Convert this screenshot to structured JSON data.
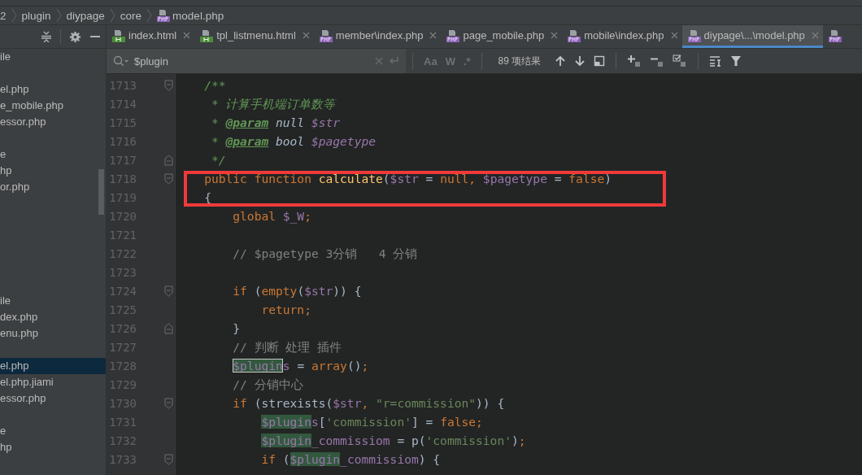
{
  "breadcrumb": [
    {
      "label": "2",
      "kind": "folder"
    },
    {
      "label": "plugin",
      "kind": "folder"
    },
    {
      "label": "diypage",
      "kind": "folder"
    },
    {
      "label": "core",
      "kind": "folder"
    },
    {
      "label": "model.php",
      "kind": "php"
    }
  ],
  "sidebar": {
    "items": [
      {
        "kind": "file",
        "label": "ile",
        "selected": false
      },
      {
        "kind": "hidden"
      },
      {
        "kind": "file",
        "label": "el.php",
        "selected": false
      },
      {
        "kind": "file",
        "label": "e_mobile.php",
        "selected": false
      },
      {
        "kind": "file",
        "label": "essor.php",
        "selected": false
      },
      {
        "kind": "hidden"
      },
      {
        "kind": "file",
        "label": "e",
        "selected": false
      },
      {
        "kind": "file",
        "label": "hp",
        "selected": false
      },
      {
        "kind": "file",
        "label": "or.php",
        "selected": false
      },
      {
        "kind": "hidden"
      },
      {
        "kind": "hidden"
      },
      {
        "kind": "hidden"
      },
      {
        "kind": "hidden"
      },
      {
        "kind": "hidden"
      },
      {
        "kind": "hidden"
      },
      {
        "kind": "file",
        "label": "ile",
        "selected": false
      },
      {
        "kind": "file",
        "label": "dex.php",
        "selected": false
      },
      {
        "kind": "file",
        "label": "enu.php",
        "selected": false
      },
      {
        "kind": "hidden"
      },
      {
        "kind": "file",
        "label": "el.php",
        "selected": true
      },
      {
        "kind": "file",
        "label": "el.php.jiami",
        "selected": false
      },
      {
        "kind": "file",
        "label": "essor.php",
        "selected": false
      },
      {
        "kind": "hidden"
      },
      {
        "kind": "file",
        "label": "e",
        "selected": false
      },
      {
        "kind": "file",
        "label": "hp",
        "selected": false
      }
    ]
  },
  "tabs": [
    {
      "label": "index.html",
      "kind": "html",
      "selected": false
    },
    {
      "label": "tpl_listmenu.html",
      "kind": "html",
      "selected": false
    },
    {
      "label": "member\\index.php",
      "kind": "php",
      "selected": false
    },
    {
      "label": "page_mobile.php",
      "kind": "php",
      "selected": false
    },
    {
      "label": "mobile\\index.php",
      "kind": "php",
      "selected": false
    },
    {
      "label": "diypage\\...\\model.php",
      "kind": "php",
      "selected": true
    },
    {
      "kind": "php",
      "selected": false
    }
  ],
  "search": {
    "value": "$plugin",
    "options": [
      "Aa",
      "W",
      ".*"
    ],
    "result_count": "89 项结果"
  },
  "code": [
    {
      "number": "1713",
      "fold_start": true,
      "fold_end": false,
      "boxed": false,
      "tokens": [
        {
          "text": "/**",
          "kind": "doc"
        }
      ]
    },
    {
      "number": "1714",
      "fold_start": false,
      "fold_end": false,
      "boxed": false,
      "tokens": [
        {
          "text": " * 计算手机端订单数等",
          "kind": "doc"
        }
      ]
    },
    {
      "number": "1715",
      "fold_start": false,
      "fold_end": false,
      "boxed": false,
      "tokens": [
        {
          "text": " * ",
          "kind": "doc"
        },
        {
          "text": "@param",
          "kind": "doctag"
        },
        {
          "text": " null ",
          "kind": "doctype"
        },
        {
          "text": "$str",
          "kind": "docvar"
        }
      ]
    },
    {
      "number": "1716",
      "fold_start": false,
      "fold_end": false,
      "boxed": false,
      "tokens": [
        {
          "text": " * ",
          "kind": "doc"
        },
        {
          "text": "@param",
          "kind": "doctag"
        },
        {
          "text": " bool ",
          "kind": "doctype"
        },
        {
          "text": "$pagetype",
          "kind": "docvar"
        }
      ]
    },
    {
      "number": "1717",
      "fold_start": false,
      "fold_end": true,
      "boxed": false,
      "tokens": [
        {
          "text": " */",
          "kind": "doc"
        }
      ]
    },
    {
      "number": "1718",
      "fold_start": true,
      "fold_end": false,
      "boxed": true,
      "tokens": [
        {
          "text": "public function",
          "kind": "keyword"
        },
        {
          "text": " calculate",
          "kind": "function"
        },
        {
          "text": "(",
          "kind": "plain"
        },
        {
          "text": "$str",
          "kind": "variable"
        },
        {
          "text": " = ",
          "kind": "plain"
        },
        {
          "text": "null,",
          "kind": "keyword"
        },
        {
          "text": " $pagetype",
          "kind": "variable"
        },
        {
          "text": " = ",
          "kind": "plain"
        },
        {
          "text": "false",
          "kind": "keyword"
        },
        {
          "text": ")",
          "kind": "plain"
        }
      ]
    },
    {
      "number": "1719",
      "fold_start": false,
      "fold_end": false,
      "boxed": true,
      "tokens": [
        {
          "text": "{",
          "kind": "plain"
        }
      ],
      "children": [
        {
          "number": "1720",
          "fold_start": false,
          "fold_end": false,
          "boxed": false,
          "tokens": [
            {
              "text": "global",
              "kind": "keyword"
            },
            {
              "text": " $_W",
              "kind": "variable"
            },
            {
              "text": ";",
              "kind": "keyword"
            }
          ]
        },
        {
          "number": "1721",
          "fold_start": false,
          "fold_end": false,
          "boxed": false
        },
        {
          "number": "1722",
          "fold_start": false,
          "fold_end": false,
          "boxed": false,
          "tokens": [
            {
              "text": "// $pagetype 3分销   4 分销",
              "kind": "comment"
            }
          ]
        },
        {
          "number": "1723",
          "fold_start": false,
          "fold_end": false,
          "boxed": false
        },
        {
          "number": "1724",
          "fold_start": true,
          "fold_end": false,
          "boxed": false,
          "tokens": [
            {
              "text": "if",
              "kind": "keyword"
            },
            {
              "text": " (",
              "kind": "plain"
            },
            {
              "text": "empty",
              "kind": "keyword"
            },
            {
              "text": "(",
              "kind": "plain"
            },
            {
              "text": "$str",
              "kind": "variable"
            },
            {
              "text": ")) {",
              "kind": "plain"
            }
          ],
          "children": [
            {
              "number": "1725",
              "fold_start": false,
              "fold_end": false,
              "boxed": false,
              "tokens": [
                {
                  "text": "return;",
                  "kind": "keyword"
                }
              ]
            }
          ]
        },
        {
          "number": "1726",
          "fold_start": false,
          "fold_end": true,
          "boxed": false,
          "tokens": [
            {
              "text": "}",
              "kind": "plain"
            }
          ]
        },
        {
          "number": "1727",
          "fold_start": false,
          "fold_end": false,
          "boxed": false,
          "tokens": [
            {
              "text": "// 判断 处理 插件",
              "kind": "comment"
            }
          ]
        },
        {
          "number": "1728",
          "fold_start": false,
          "fold_end": false,
          "boxed": false,
          "tokens": [
            {
              "text": "$plugin",
              "kind": "variable",
              "match": true,
              "current": true
            },
            {
              "text": "s",
              "kind": "variable"
            },
            {
              "text": " = ",
              "kind": "plain"
            },
            {
              "text": "array",
              "kind": "keyword"
            },
            {
              "text": "()",
              "kind": "plain"
            },
            {
              "text": ";",
              "kind": "keyword"
            }
          ]
        },
        {
          "number": "1729",
          "fold_start": false,
          "fold_end": false,
          "boxed": false,
          "tokens": [
            {
              "text": "// 分销中心",
              "kind": "comment"
            }
          ]
        },
        {
          "number": "1730",
          "fold_start": true,
          "fold_end": false,
          "boxed": false,
          "tokens": [
            {
              "text": "if",
              "kind": "keyword"
            },
            {
              "text": " (strexists(",
              "kind": "plain"
            },
            {
              "text": "$str",
              "kind": "variable"
            },
            {
              "text": ", ",
              "kind": "keyword"
            },
            {
              "text": "\"r=commission\"",
              "kind": "string"
            },
            {
              "text": ")) {",
              "kind": "plain"
            }
          ],
          "children": [
            {
              "number": "1731",
              "fold_start": false,
              "fold_end": false,
              "boxed": false,
              "tokens": [
                {
                  "text": "$plugin",
                  "kind": "variable",
                  "match": true,
                  "current": false
                },
                {
                  "text": "s",
                  "kind": "variable"
                },
                {
                  "text": "[",
                  "kind": "plain"
                },
                {
                  "text": "'commission'",
                  "kind": "string"
                },
                {
                  "text": "] = ",
                  "kind": "plain"
                },
                {
                  "text": "false",
                  "kind": "keyword"
                },
                {
                  "text": ";",
                  "kind": "keyword"
                }
              ]
            },
            {
              "number": "1732",
              "fold_start": false,
              "fold_end": false,
              "boxed": false,
              "tokens": [
                {
                  "text": "$plugin",
                  "kind": "variable",
                  "match": true,
                  "current": false
                },
                {
                  "text": "_commissiom",
                  "kind": "variable"
                },
                {
                  "text": " = p(",
                  "kind": "plain"
                },
                {
                  "text": "'commission'",
                  "kind": "string"
                },
                {
                  "text": ")",
                  "kind": "plain"
                },
                {
                  "text": ";",
                  "kind": "keyword"
                }
              ]
            },
            {
              "number": "1733",
              "fold_start": true,
              "fold_end": false,
              "boxed": false,
              "tokens": [
                {
                  "text": "if",
                  "kind": "keyword"
                },
                {
                  "text": " (",
                  "kind": "plain"
                },
                {
                  "text": "$plugin",
                  "kind": "variable",
                  "match": true,
                  "current": false
                },
                {
                  "text": "_commissiom",
                  "kind": "variable"
                },
                {
                  "text": ") {",
                  "kind": "plain"
                }
              ]
            }
          ]
        }
      ]
    }
  ]
}
